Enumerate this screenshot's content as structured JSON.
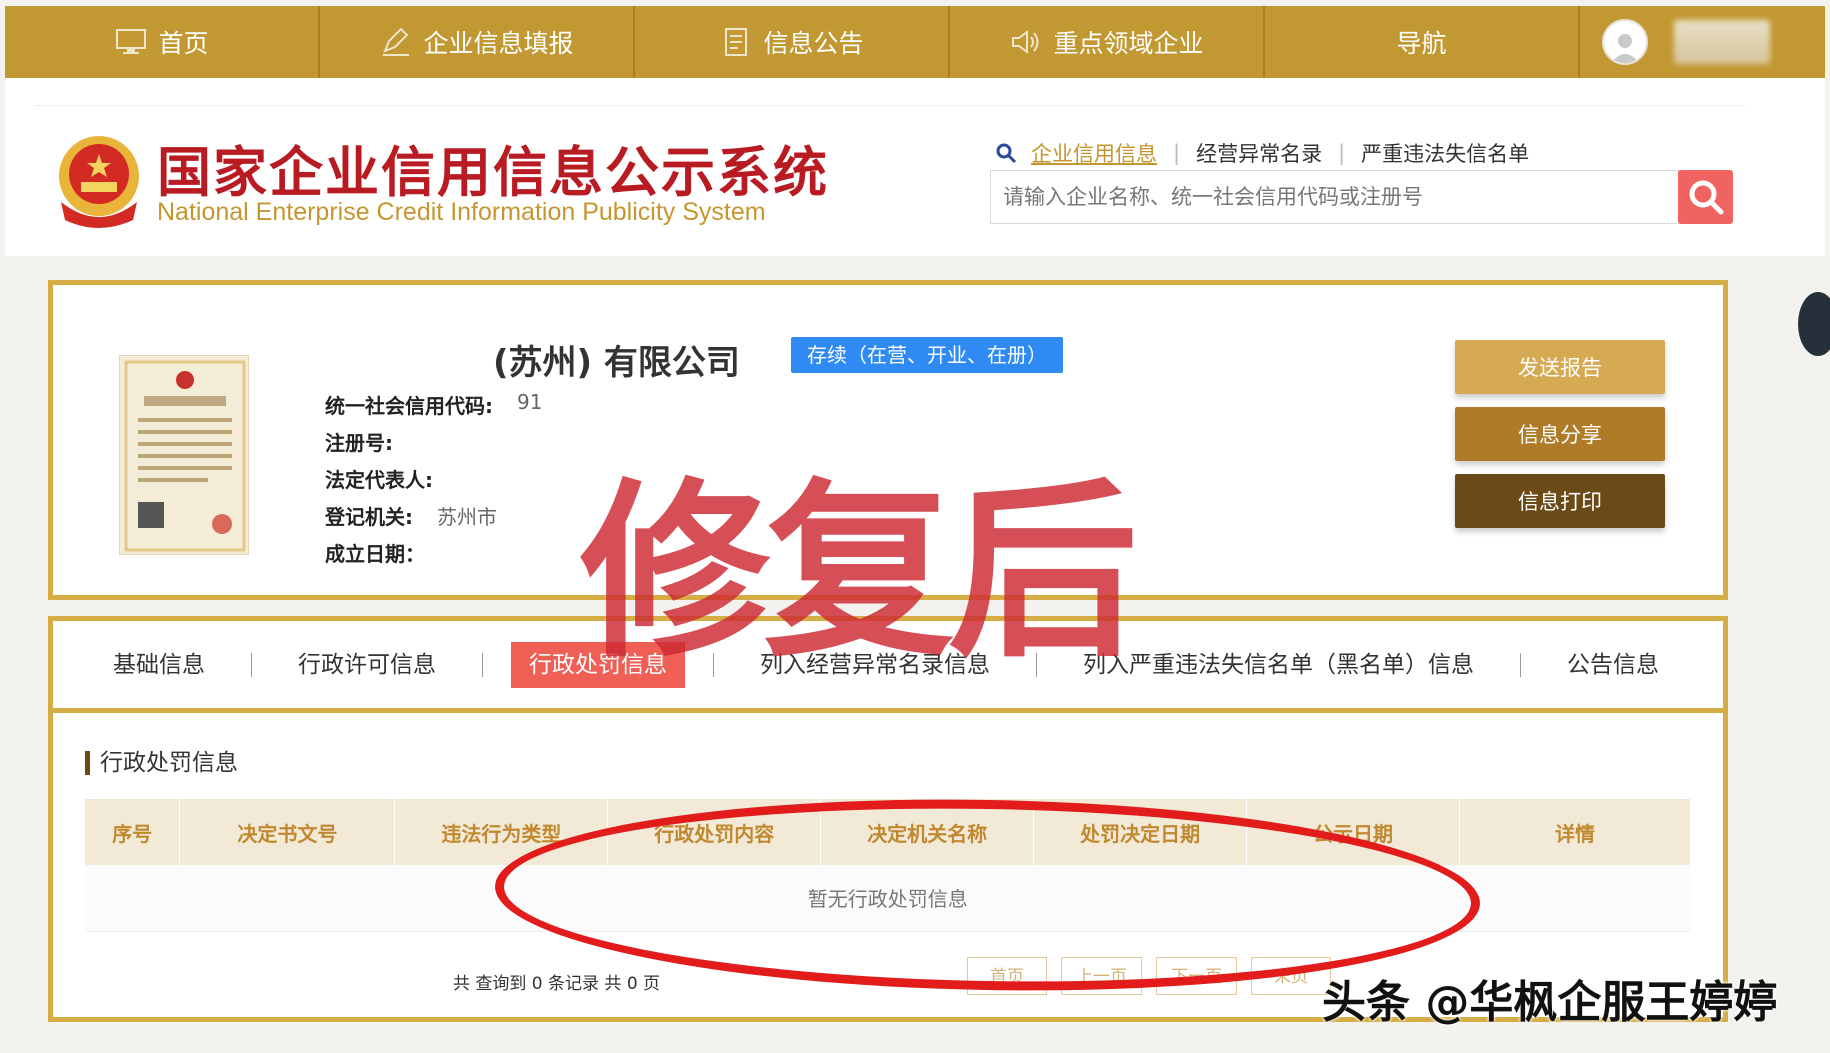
{
  "nav": {
    "home": "首页",
    "report": "企业信息填报",
    "notice": "信息公告",
    "key_sectors": "重点领域企业",
    "navigation": "导航"
  },
  "header": {
    "title": "国家企业信用信息公示系统",
    "subtitle": "National Enterprise Credit Information Publicity System",
    "search_links": [
      "企业信用信息",
      "经营异常名录",
      "严重违法失信名单"
    ],
    "search_placeholder": "请输入企业名称、统一社会信用代码或注册号"
  },
  "company": {
    "name": "(苏州) 有限公司",
    "status": "存续（在营、开业、在册）",
    "fields": [
      {
        "label": "统一社会信用代码:",
        "value": "91"
      },
      {
        "label": "注册号:",
        "value": ""
      },
      {
        "label": "法定代表人:",
        "value": ""
      },
      {
        "label": "登记机关:",
        "value": "苏州市"
      },
      {
        "label": "成立日期：",
        "value": ""
      }
    ],
    "buttons": {
      "send_report": "发送报告",
      "share": "信息分享",
      "print": "信息打印"
    }
  },
  "tabs": [
    "基础信息",
    "行政许可信息",
    "行政处罚信息",
    "列入经营异常名录信息",
    "列入严重违法失信名单（黑名单）信息",
    "公告信息"
  ],
  "penalty": {
    "section_title": "行政处罚信息",
    "columns": [
      "序号",
      "决定书文号",
      "违法行为类型",
      "行政处罚内容",
      "决定机关名称",
      "处罚决定日期",
      "公示日期",
      "详情"
    ],
    "empty_text": "暂无行政处罚信息",
    "count_text": "共 查询到 0 条记录 共 0 页",
    "pager": [
      "首页",
      "上一页",
      "下一页",
      "末页"
    ]
  },
  "overlay": {
    "label": "修复后",
    "watermark": "头条 @华枫企服王婷婷"
  },
  "colors": {
    "nav_gold": "#c29832",
    "title_red": "#b81c22",
    "border_gold": "#d6ad45",
    "status_blue": "#2f8bf3",
    "active_tab": "#ef5f55"
  }
}
